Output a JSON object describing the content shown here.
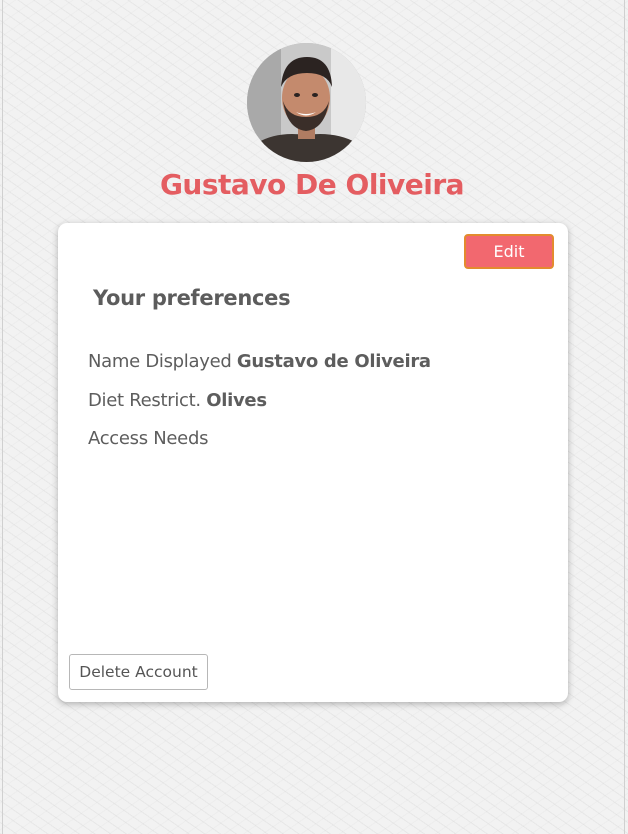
{
  "profile": {
    "name": "Gustavo De Oliveira"
  },
  "card": {
    "edit_label": "Edit",
    "section_title": "Your preferences",
    "preferences": [
      {
        "label": "Name Displayed",
        "value": "Gustavo de Oliveira"
      },
      {
        "label": "Diet Restrict.",
        "value": "Olives"
      },
      {
        "label": "Access Needs",
        "value": ""
      }
    ],
    "delete_label": "Delete Account"
  },
  "colors": {
    "accent": "#e45d61",
    "edit_button_bg": "#f2686f",
    "edit_button_border": "#e38b2e"
  }
}
